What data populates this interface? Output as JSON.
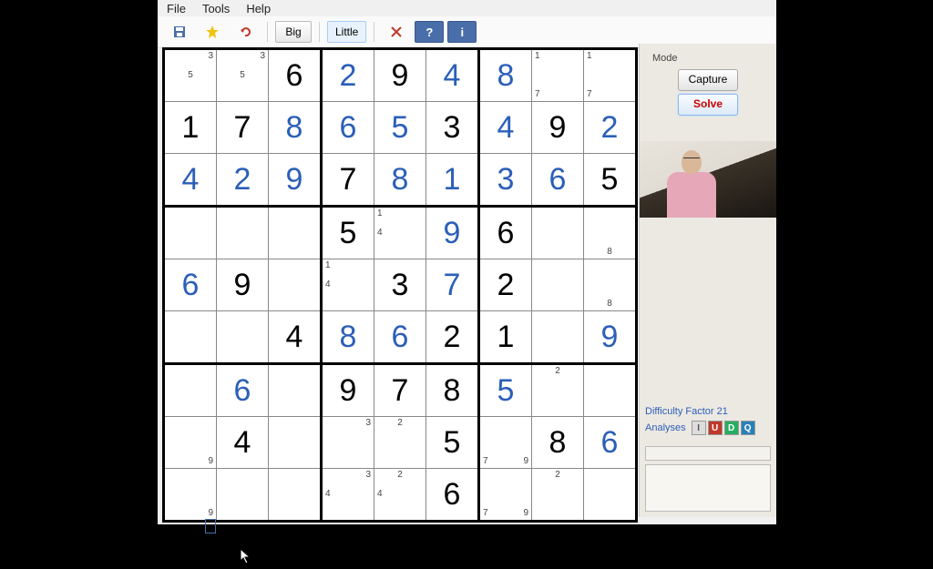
{
  "menu": {
    "file": "File",
    "tools": "Tools",
    "help": "Help"
  },
  "toolbar": {
    "big": "Big",
    "little": "Little",
    "icons": {
      "save": "save",
      "fav": "favorite",
      "undo": "undo",
      "del": "delete",
      "help": "?",
      "info": "i"
    }
  },
  "side": {
    "mode_label": "Mode",
    "capture": "Capture",
    "solve": "Solve",
    "difficulty_label": "Difficulty Factor 21",
    "analyses_label": "Analyses",
    "an": [
      "I",
      "U",
      "D",
      "Q"
    ]
  },
  "board": {
    "rows": [
      [
        {
          "pm": {
            "3": "3",
            "5": "5"
          }
        },
        {
          "pm": {
            "3": "3",
            "5": "5"
          }
        },
        {
          "v": "6",
          "t": "given"
        },
        {
          "v": "2",
          "t": "solved"
        },
        {
          "v": "9",
          "t": "given"
        },
        {
          "v": "4",
          "t": "solved"
        },
        {
          "v": "8",
          "t": "solved"
        },
        {
          "pm": {
            "1": "1",
            "7": "7"
          }
        },
        {
          "pm": {
            "1": "1",
            "7": "7"
          }
        }
      ],
      [
        {
          "v": "1",
          "t": "given"
        },
        {
          "v": "7",
          "t": "given"
        },
        {
          "v": "8",
          "t": "solved"
        },
        {
          "v": "6",
          "t": "solved"
        },
        {
          "v": "5",
          "t": "solved"
        },
        {
          "v": "3",
          "t": "given"
        },
        {
          "v": "4",
          "t": "solved"
        },
        {
          "v": "9",
          "t": "given"
        },
        {
          "v": "2",
          "t": "solved"
        }
      ],
      [
        {
          "v": "4",
          "t": "solved"
        },
        {
          "v": "2",
          "t": "solved"
        },
        {
          "v": "9",
          "t": "solved"
        },
        {
          "v": "7",
          "t": "given"
        },
        {
          "v": "8",
          "t": "solved"
        },
        {
          "v": "1",
          "t": "solved"
        },
        {
          "v": "3",
          "t": "solved"
        },
        {
          "v": "6",
          "t": "solved"
        },
        {
          "v": "5",
          "t": "given"
        }
      ],
      [
        {},
        {},
        {},
        {
          "v": "5",
          "t": "given"
        },
        {
          "pm": {
            "1": "1",
            "4": "4"
          }
        },
        {
          "v": "9",
          "t": "solved"
        },
        {
          "v": "6",
          "t": "given"
        },
        {},
        {
          "pm": {
            "8": "8"
          }
        }
      ],
      [
        {
          "v": "6",
          "t": "solved"
        },
        {
          "v": "9",
          "t": "given"
        },
        {},
        {
          "pm": {
            "1": "1",
            "4": "4"
          }
        },
        {
          "v": "3",
          "t": "given"
        },
        {
          "v": "7",
          "t": "solved"
        },
        {
          "v": "2",
          "t": "given"
        },
        {},
        {
          "pm": {
            "8": "8"
          }
        }
      ],
      [
        {},
        {},
        {
          "v": "4",
          "t": "given"
        },
        {
          "v": "8",
          "t": "solved"
        },
        {
          "v": "6",
          "t": "solved"
        },
        {
          "v": "2",
          "t": "given"
        },
        {
          "v": "1",
          "t": "given"
        },
        {},
        {
          "v": "9",
          "t": "solved"
        }
      ],
      [
        {},
        {
          "v": "6",
          "t": "solved"
        },
        {},
        {
          "v": "9",
          "t": "given"
        },
        {
          "v": "7",
          "t": "given"
        },
        {
          "v": "8",
          "t": "given"
        },
        {
          "v": "5",
          "t": "solved"
        },
        {
          "pm": {
            "2": "2"
          }
        },
        {}
      ],
      [
        {
          "pm": {
            "9": "9"
          }
        },
        {
          "v": "4",
          "t": "given"
        },
        {},
        {
          "pm": {
            "3": "3"
          }
        },
        {
          "pm": {
            "2": "2"
          }
        },
        {
          "v": "5",
          "t": "given"
        },
        {
          "pm": {
            "7": "7",
            "9": "9"
          }
        },
        {
          "v": "8",
          "t": "given"
        },
        {
          "v": "6",
          "t": "solved"
        }
      ],
      [
        {
          "pm": {
            "9": "9"
          }
        },
        {},
        {},
        {
          "pm": {
            "3": "3",
            "4": "4"
          }
        },
        {
          "pm": {
            "2": "2",
            "4": "4"
          }
        },
        {
          "v": "6",
          "t": "given"
        },
        {
          "pm": {
            "7": "7",
            "9": "9"
          }
        },
        {
          "pm": {
            "2": "2"
          }
        },
        {}
      ]
    ]
  }
}
